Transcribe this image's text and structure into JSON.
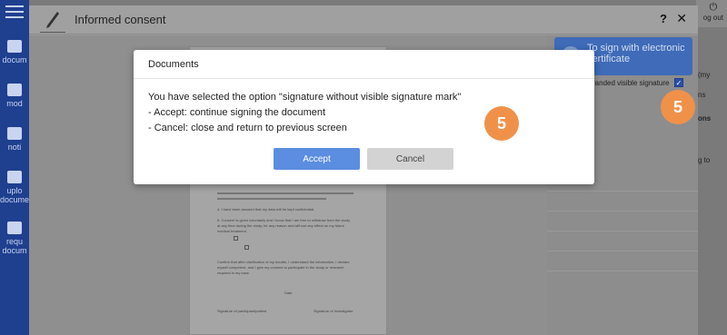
{
  "sidebar": {
    "items": [
      {
        "label": "documents",
        "short": "docum"
      },
      {
        "label": "models",
        "short": "mod"
      },
      {
        "label": "notifications",
        "short": "noti"
      },
      {
        "label": "upload documents",
        "short": "uplo docume"
      },
      {
        "label": "request documents",
        "short": "requ docum"
      }
    ]
  },
  "header": {
    "logout_label": "og out"
  },
  "consent": {
    "title": "Informed consent",
    "help_label": "?",
    "close_label": "✕"
  },
  "right_panel": {
    "sign_button_label": "To sign with electronic certificate",
    "branded_label": "randed visible signature",
    "branded_checked": true
  },
  "edge_texts": [
    "(my",
    "ns",
    "ons",
    "g to"
  ],
  "modal": {
    "title": "Documents",
    "messages": [
      "You have selected the option \"signature without visible signature mark\"",
      "- Accept: continue signing the document",
      "- Cancel: close and return to previous screen"
    ],
    "accept_label": "Accept",
    "cancel_label": "Cancel"
  },
  "badges": [
    "5",
    "5"
  ],
  "document": {
    "lines": [
      "4. I have been assured that my data will be kept confidential.",
      "5. Consent is given voluntarily and I know that I am free to withdraw from the study",
      "at any time during the study, for any reason and without any effect on my future",
      "medical treatment.",
      "Confirm that after clarification of my doubts, I understand the information, I declare",
      "myself competent, and I give my consent to participate in the study or research",
      "required in my case."
    ],
    "date_label": "Date",
    "signature_participant": "Signature of participant/patient",
    "signature_investigator": "Signature of Investigator"
  }
}
